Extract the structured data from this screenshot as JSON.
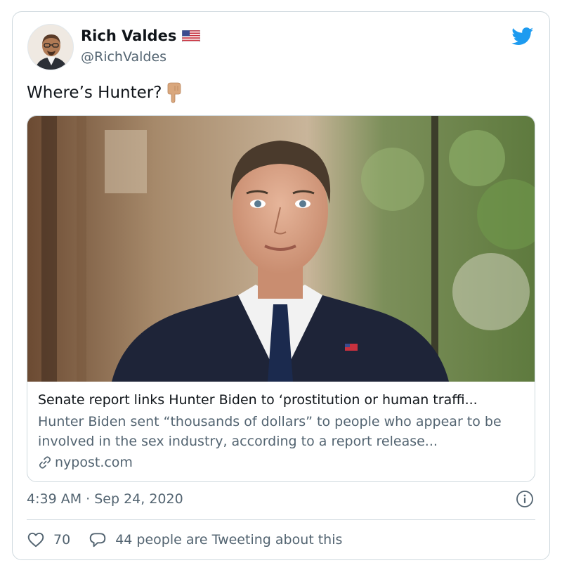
{
  "tweet": {
    "display_name": "Rich Valdes",
    "handle": "@RichValdes",
    "text": "Where’s Hunter?",
    "timestamp": "4:39 AM · Sep 24, 2020"
  },
  "link_card": {
    "title": "Senate report links Hunter Biden to ‘prostitution or human traffi...",
    "description": "Hunter Biden sent “thousands of dollars” to people who appear to be involved in the sex industry, according to a report release...",
    "domain": "nypost.com"
  },
  "actions": {
    "likes": "70",
    "conversation": "44 people are Tweeting about this"
  },
  "colors": {
    "twitter_blue": "#1d9bf0",
    "secondary_text": "#536471",
    "border": "#cfd9de"
  },
  "icons": [
    "twitter-bird-icon",
    "us-flag-icon",
    "finger-pointing-down-emoji",
    "link-icon",
    "info-icon",
    "heart-icon",
    "speech-bubble-icon"
  ]
}
